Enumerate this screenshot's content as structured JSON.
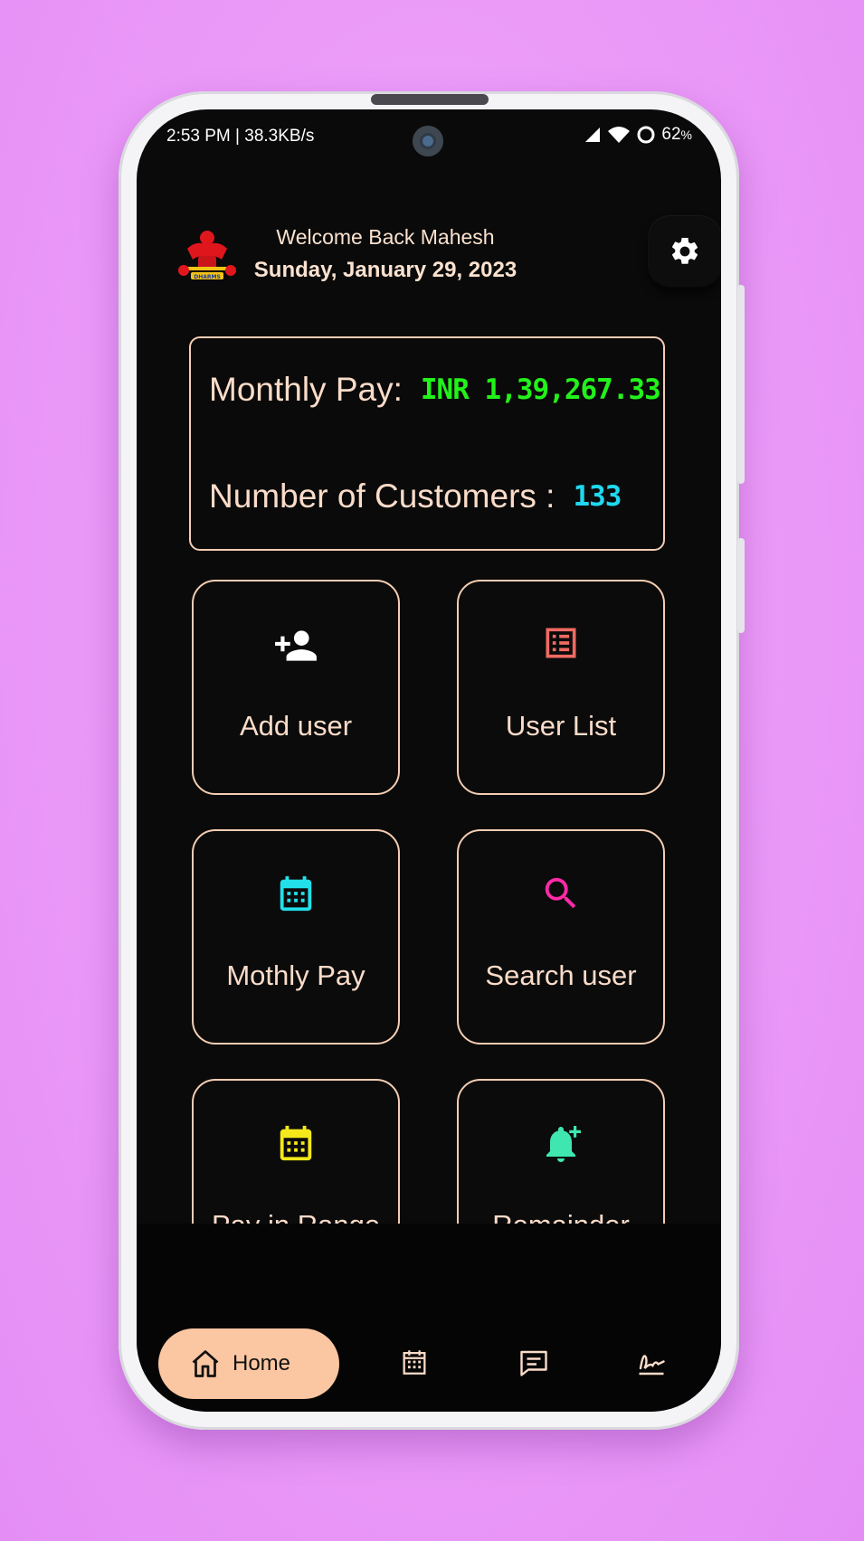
{
  "status_bar": {
    "time": "2:53 PM | 38.3KB/s",
    "battery": "62",
    "battery_unit": "%"
  },
  "header": {
    "logo_text": "DHARMS",
    "welcome": "Welcome Back Mahesh",
    "date": "Sunday, January 29, 2023"
  },
  "stats": {
    "monthly_pay_label": "Monthly Pay:",
    "monthly_pay_value": "INR 1,39,267.33",
    "customers_label": "Number of Customers :",
    "customers_value": "133"
  },
  "tiles": [
    {
      "label": "Add user",
      "icon": "add-user-icon",
      "color": "#ffffff"
    },
    {
      "label": "User List",
      "icon": "list-icon",
      "color": "#f06a62"
    },
    {
      "label": "Mothly Pay",
      "icon": "calendar-icon",
      "color": "#22e0ea"
    },
    {
      "label": "Search user",
      "icon": "search-icon",
      "color": "#ff2aa8"
    },
    {
      "label": "Pay in Range",
      "icon": "calendar-icon",
      "color": "#f4e81a"
    },
    {
      "label": "Remainder",
      "icon": "bell-add-icon",
      "color": "#3fe6b0"
    }
  ],
  "bottom_nav": {
    "home_label": "Home",
    "items": [
      "calendar-icon",
      "message-icon",
      "signature-icon"
    ]
  },
  "colors": {
    "accent": "#fbc6a2",
    "monthly_pay_value": "#22f21a",
    "customers_value": "#1fd8f0",
    "border": "#f4cdb3"
  }
}
